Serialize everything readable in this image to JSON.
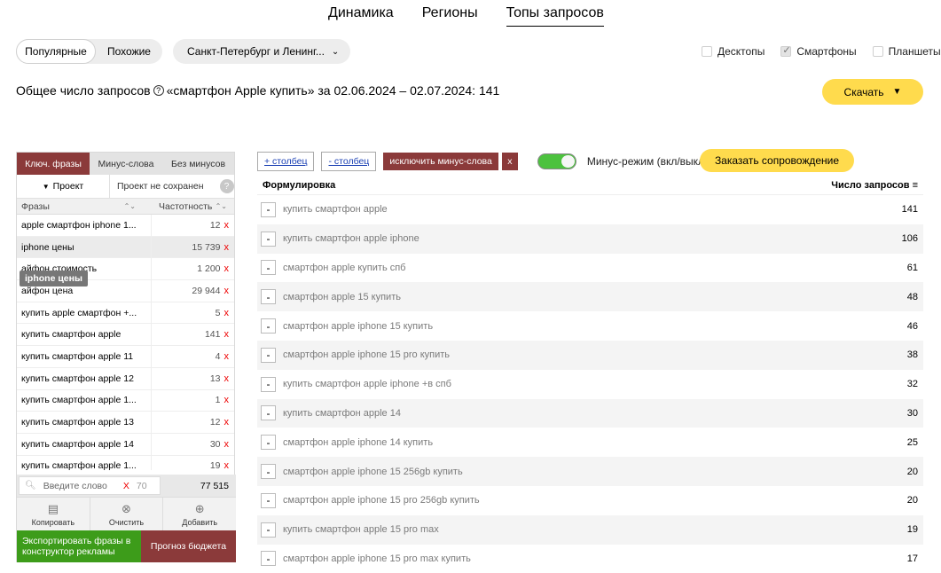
{
  "nav": {
    "tabs": [
      "Динамика",
      "Регионы",
      "Топы запросов"
    ],
    "active": 2
  },
  "mode": {
    "popular": "Популярные",
    "similar": "Похожие"
  },
  "region": {
    "label": "Санкт-Петербург и Ленинг..."
  },
  "devices": [
    {
      "label": "Десктопы",
      "checked": false
    },
    {
      "label": "Смартфоны",
      "checked": true
    },
    {
      "label": "Планшеты",
      "checked": false
    }
  ],
  "summary": {
    "prefix": "Общее число запросов",
    "text": "«смартфон Apple купить» за 02.06.2024 – 02.07.2024: 141"
  },
  "download": {
    "label": "Скачать"
  },
  "left": {
    "tabs": [
      "Ключ. фразы",
      "Минус-слова",
      "Без минусов"
    ],
    "project": "Проект",
    "project_status": "Проект не сохранен",
    "help": "?",
    "col_phrases": "Фразы",
    "col_freq": "Частотность",
    "rows": [
      {
        "phrase": "apple смартфон iphone 1...",
        "freq": "12"
      },
      {
        "phrase": "iphone цены",
        "freq": "15 739"
      },
      {
        "phrase": "айфон стоимость",
        "freq": "1 200"
      },
      {
        "phrase": "айфон цена",
        "freq": "29 944"
      },
      {
        "phrase": "купить apple смартфон +...",
        "freq": "5"
      },
      {
        "phrase": "купить смартфон apple",
        "freq": "141"
      },
      {
        "phrase": "купить смартфон apple 11",
        "freq": "4"
      },
      {
        "phrase": "купить смартфон apple 12",
        "freq": "13"
      },
      {
        "phrase": "купить смартфон apple 1...",
        "freq": "1"
      },
      {
        "phrase": "купить смартфон apple 13",
        "freq": "12"
      },
      {
        "phrase": "купить смартфон apple 14",
        "freq": "30"
      },
      {
        "phrase": "купить смартфон apple 1...",
        "freq": "19"
      }
    ],
    "tooltip": "iphone цены",
    "search_placeholder": "Введите слово",
    "search_x": "X",
    "search_count": "70",
    "total": "77 515",
    "copy": "Копировать",
    "clear": "Очистить",
    "add": "Добавить",
    "export": "Экспортировать фразы в конструктор рекламы",
    "forecast": "Прогноз бюджета"
  },
  "toolbar": {
    "add_col": "+ столбец",
    "remove_col": "- столбец",
    "exclude": "исключить минус-слова",
    "x": "x",
    "minus_mode": "Минус-режим (вкл/выкл)",
    "order": "Заказать сопровождение"
  },
  "table": {
    "col_phrase": "Формулировка",
    "col_count": "Число запросов",
    "rows": [
      {
        "phrase": "купить смартфон apple",
        "count": "141"
      },
      {
        "phrase": "купить смартфон apple iphone",
        "count": "106"
      },
      {
        "phrase": "смартфон apple купить спб",
        "count": "61"
      },
      {
        "phrase": "смартфон apple 15 купить",
        "count": "48"
      },
      {
        "phrase": "смартфон apple iphone 15 купить",
        "count": "46"
      },
      {
        "phrase": "смартфон apple iphone 15 pro купить",
        "count": "38"
      },
      {
        "phrase": "купить смартфон apple iphone +в спб",
        "count": "32"
      },
      {
        "phrase": "купить смартфон apple 14",
        "count": "30"
      },
      {
        "phrase": "смартфон apple iphone 14 купить",
        "count": "25"
      },
      {
        "phrase": "смартфон apple iphone 15 256gb купить",
        "count": "20"
      },
      {
        "phrase": "смартфон apple iphone 15 pro 256gb купить",
        "count": "20"
      },
      {
        "phrase": "купить смартфон apple 15 pro max",
        "count": "19"
      },
      {
        "phrase": "смартфон apple iphone 15 pro max купить",
        "count": "17"
      }
    ]
  }
}
